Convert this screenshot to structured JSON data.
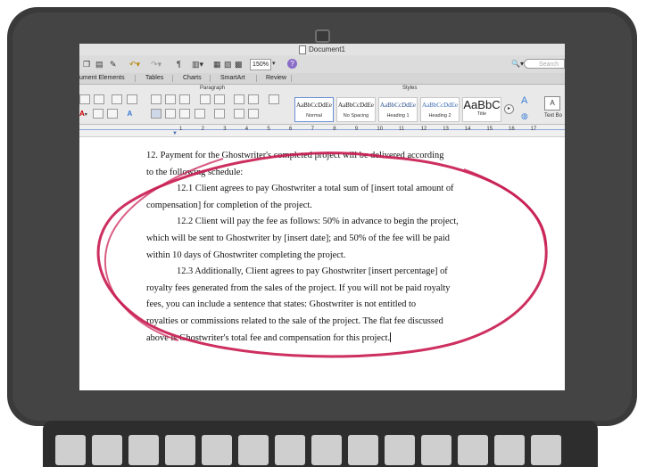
{
  "window": {
    "title": "Document1"
  },
  "toolbar": {
    "zoom": "150%",
    "help": "?",
    "search_placeholder": "Search"
  },
  "tabs": [
    "ument Elements",
    "Tables",
    "Charts",
    "SmartArt",
    "Review"
  ],
  "ribbon": {
    "paragraph_label": "Paragraph",
    "styles_label": "Styles",
    "text_box_label": "Text Bo",
    "styles": [
      {
        "preview": "AaBbCcDdEe",
        "name": "Normal"
      },
      {
        "preview": "AaBbCcDdEe",
        "name": "No Spacing"
      },
      {
        "preview": "AaBbCcDdEe",
        "name": "Heading 1"
      },
      {
        "preview": "AaBbCcDdEe",
        "name": "Heading 2"
      },
      {
        "preview": "AaBbC",
        "name": "Title"
      }
    ]
  },
  "ruler": {
    "numbers": [
      "1",
      "2",
      "3",
      "4",
      "5",
      "6",
      "7",
      "8",
      "9",
      "10",
      "11",
      "12",
      "13",
      "14",
      "15",
      "16",
      "17"
    ]
  },
  "document": {
    "lines": [
      "12. Payment for the Ghostwriter's completed project will be delivered according",
      "to the following schedule:",
      "12.1 Client agrees to pay Ghostwriter a total sum of [insert total amount of",
      "compensation] for completion of the project.",
      "12.2 Client will pay the fee as follows: 50% in advance to begin the project,",
      "which will be sent to Ghostwriter by [insert date]; and 50% of the fee will be paid",
      "within 10 days of Ghostwriter completing the project.",
      "12.3 Additionally, Client agrees to pay Ghostwriter [insert percentage] of",
      "royalty fees generated from the sales of the project. If you will not be paid royalty",
      "fees, you can include a sentence that states: Ghostwriter is not entitled to",
      "royalties or commissions related to the sale of the project. The flat fee discussed",
      "above is Ghostwriter's total fee and compensation for this project."
    ]
  },
  "colors": {
    "highlight_ellipse": "#c8184f",
    "laptop_bezel": "#3a3a3a"
  }
}
